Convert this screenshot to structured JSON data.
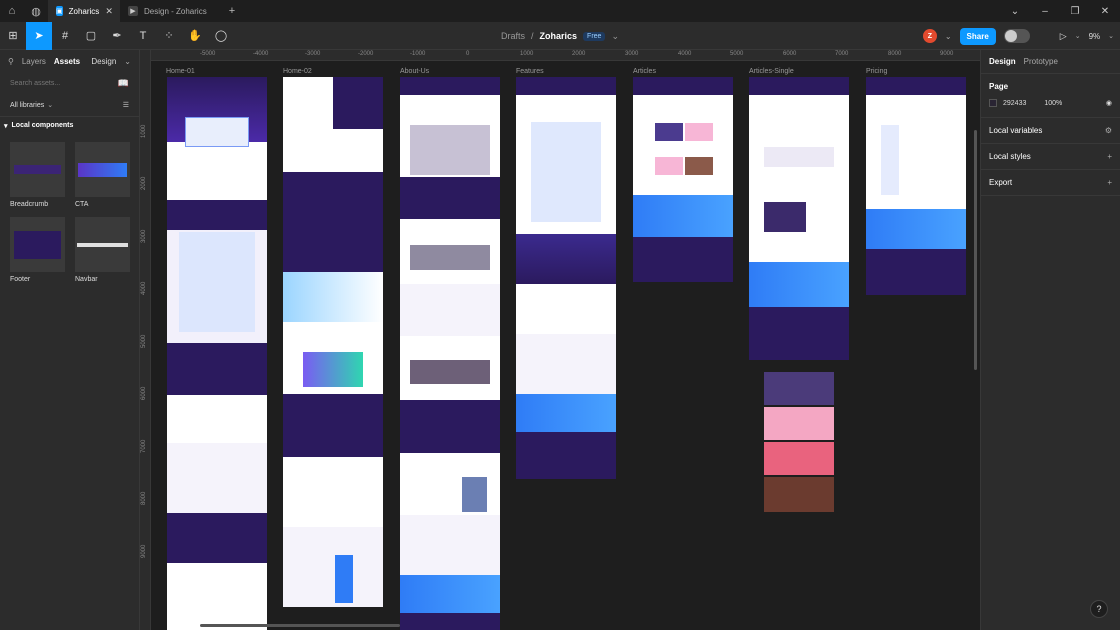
{
  "titlebar": {
    "tabs": [
      {
        "label": "Zoharics",
        "active": true
      },
      {
        "label": "Design - Zoharics",
        "active": false
      }
    ]
  },
  "toolbar": {
    "breadcrumb_folder": "Drafts",
    "separator": "/",
    "file_name": "Zoharics",
    "plan_badge": "Free",
    "avatar_initial": "Z",
    "share_label": "Share",
    "zoom": "9%"
  },
  "left_panel": {
    "tabs": [
      "Layers",
      "Assets"
    ],
    "page_label": "Design",
    "search_placeholder": "Search assets...",
    "libraries_label": "All libraries",
    "local_components_label": "Local components",
    "components": [
      {
        "label": "Breadcrumb"
      },
      {
        "label": "CTA"
      },
      {
        "label": "Footer"
      },
      {
        "label": "Navbar"
      }
    ]
  },
  "right_panel": {
    "tabs": [
      "Design",
      "Prototype"
    ],
    "page_title": "Page",
    "page_color": "292433",
    "page_opacity": "100%",
    "sections": [
      "Local variables",
      "Local styles",
      "Export"
    ]
  },
  "canvas": {
    "ruler_x": [
      "-5000",
      "-4000",
      "-3000",
      "-2000",
      "-1000",
      "0",
      "1000",
      "2000",
      "3000",
      "4000",
      "5000",
      "6000",
      "7000",
      "8000",
      "9000"
    ],
    "ruler_y": [
      "1000",
      "2000",
      "3000",
      "4000",
      "5000",
      "6000",
      "7000",
      "8000",
      "9000"
    ],
    "frames": [
      {
        "label": "Home-01"
      },
      {
        "label": "Home-02"
      },
      {
        "label": "About-Us"
      },
      {
        "label": "Features"
      },
      {
        "label": "Articles"
      },
      {
        "label": "Articles-Single"
      },
      {
        "label": "Pricing"
      }
    ]
  },
  "colors": {
    "accent": "#0d99ff",
    "canvas_bg": "#1e1e1e",
    "panel_bg": "#2c2c2c",
    "frame_purple": "#2b1a5e",
    "frame_blue": "#2f7cf6"
  },
  "help_label": "?"
}
